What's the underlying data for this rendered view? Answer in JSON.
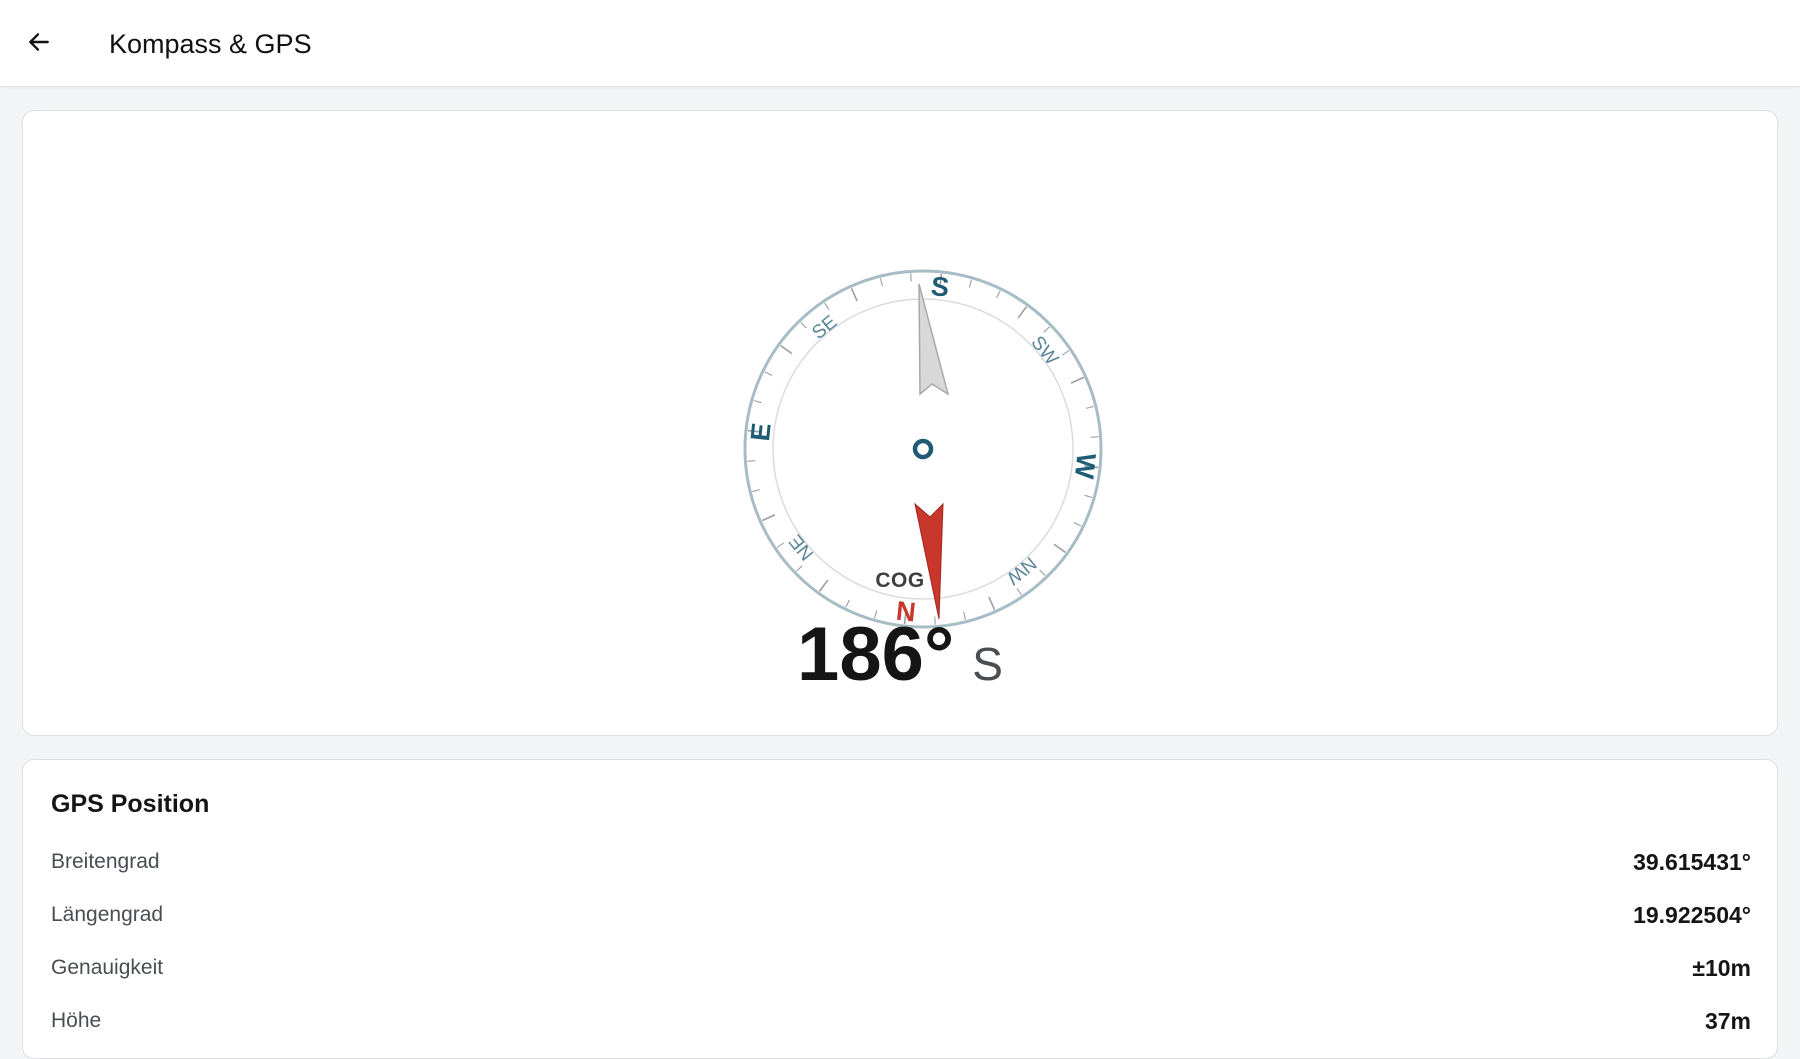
{
  "appbar": {
    "title": "Kompass & GPS",
    "back_icon": "arrow-left-icon"
  },
  "compass": {
    "cardinals": [
      "N",
      "E",
      "S",
      "W"
    ],
    "intercardinals": [
      "NE",
      "SE",
      "SW",
      "NW"
    ],
    "heading_deg": 186,
    "colors": {
      "accent": "#1d5c73",
      "north": "#c9372c",
      "ring": "#a7bdc6"
    }
  },
  "cog": {
    "label": "COG",
    "value": "186°",
    "direction": "S"
  },
  "gps": {
    "title": "GPS Position",
    "rows": [
      {
        "label": "Breitengrad",
        "value": "39.615431°"
      },
      {
        "label": "Längengrad",
        "value": "19.922504°"
      },
      {
        "label": "Genauigkeit",
        "value": "±10m"
      },
      {
        "label": "Höhe",
        "value": "37m"
      }
    ]
  }
}
